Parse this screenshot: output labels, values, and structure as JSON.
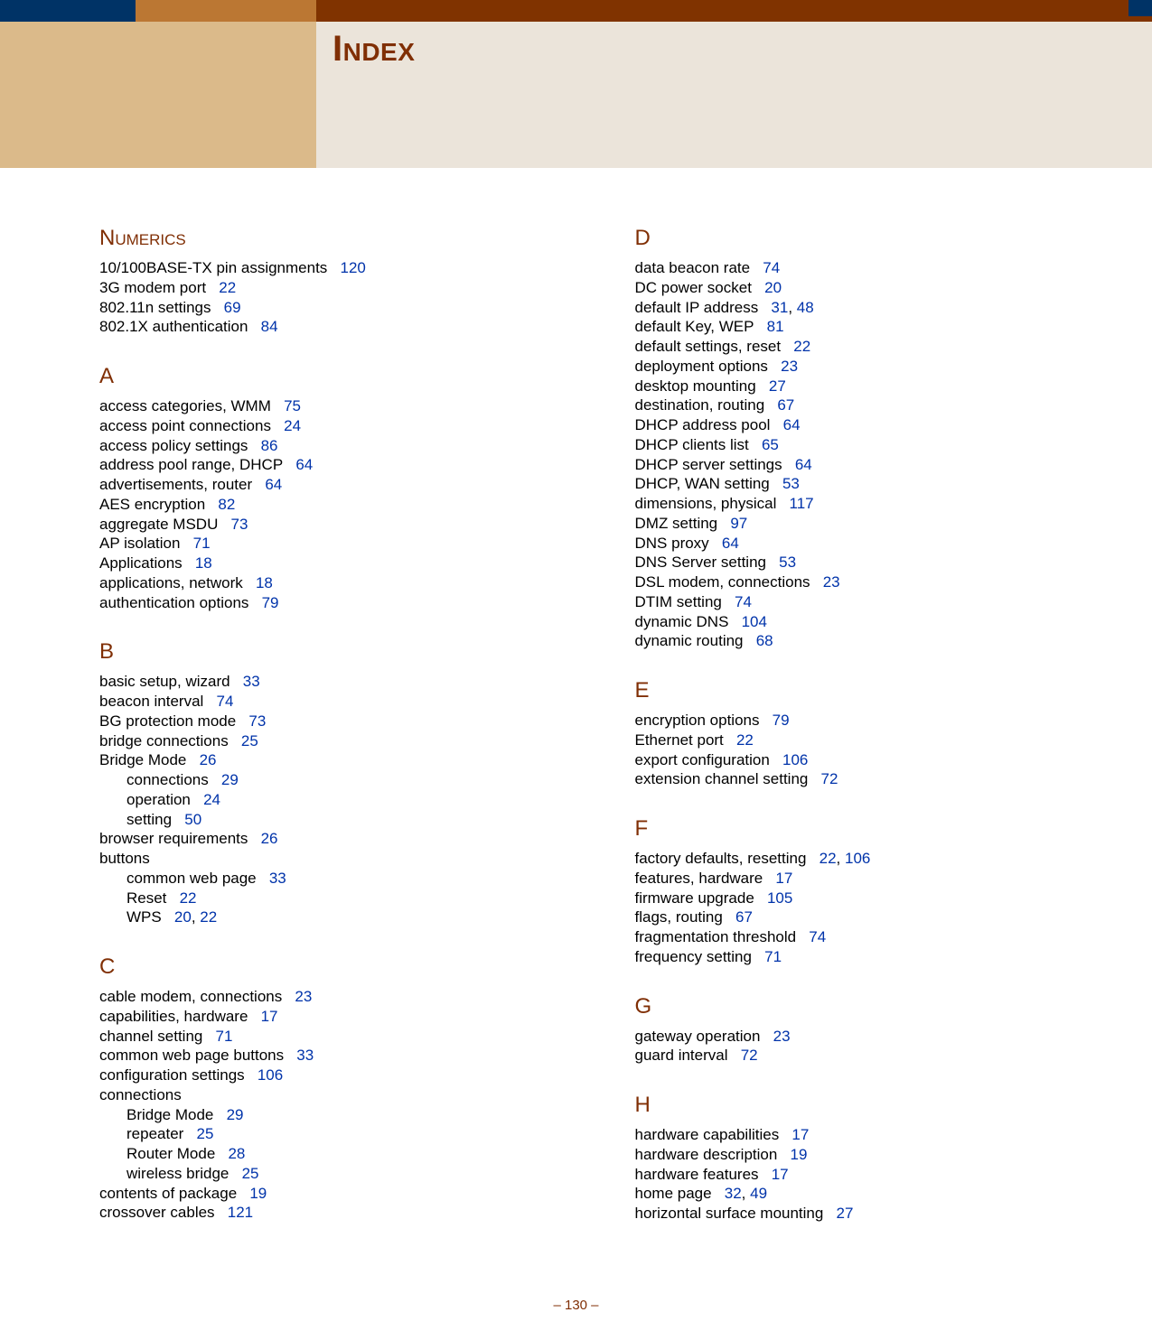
{
  "page_title": "Index",
  "footer_page_number": "–  130  –",
  "columns": [
    [
      {
        "heading": "Numerics",
        "first": true
      },
      {
        "text": "10/100BASE-TX pin assignments",
        "pages": [
          "120"
        ]
      },
      {
        "text": "3G modem port",
        "pages": [
          "22"
        ]
      },
      {
        "text": "802.11n settings",
        "pages": [
          "69"
        ]
      },
      {
        "text": "802.1X authentication",
        "pages": [
          "84"
        ]
      },
      {
        "heading": "A"
      },
      {
        "text": "access categories, WMM",
        "pages": [
          "75"
        ]
      },
      {
        "text": "access point connections",
        "pages": [
          "24"
        ]
      },
      {
        "text": "access policy settings",
        "pages": [
          "86"
        ]
      },
      {
        "text": "address pool range, DHCP",
        "pages": [
          "64"
        ]
      },
      {
        "text": "advertisements, router",
        "pages": [
          "64"
        ]
      },
      {
        "text": "AES encryption",
        "pages": [
          "82"
        ]
      },
      {
        "text": "aggregate MSDU",
        "pages": [
          "73"
        ]
      },
      {
        "text": "AP isolation",
        "pages": [
          "71"
        ]
      },
      {
        "text": "Applications",
        "pages": [
          "18"
        ]
      },
      {
        "text": "applications, network",
        "pages": [
          "18"
        ]
      },
      {
        "text": "authentication options",
        "pages": [
          "79"
        ]
      },
      {
        "heading": "B"
      },
      {
        "text": "basic setup, wizard",
        "pages": [
          "33"
        ]
      },
      {
        "text": "beacon interval",
        "pages": [
          "74"
        ]
      },
      {
        "text": "BG protection mode",
        "pages": [
          "73"
        ]
      },
      {
        "text": "bridge connections",
        "pages": [
          "25"
        ]
      },
      {
        "text": "Bridge Mode",
        "pages": [
          "26"
        ]
      },
      {
        "text": "connections",
        "pages": [
          "29"
        ],
        "sub": true
      },
      {
        "text": "operation",
        "pages": [
          "24"
        ],
        "sub": true
      },
      {
        "text": "setting",
        "pages": [
          "50"
        ],
        "sub": true
      },
      {
        "text": "browser requirements",
        "pages": [
          "26"
        ]
      },
      {
        "text": "buttons"
      },
      {
        "text": "common web page",
        "pages": [
          "33"
        ],
        "sub": true
      },
      {
        "text": "Reset",
        "pages": [
          "22"
        ],
        "sub": true
      },
      {
        "text": "WPS",
        "pages": [
          "20",
          "22"
        ],
        "sub": true
      },
      {
        "heading": "C"
      },
      {
        "text": "cable modem, connections",
        "pages": [
          "23"
        ]
      },
      {
        "text": "capabilities, hardware",
        "pages": [
          "17"
        ]
      },
      {
        "text": "channel setting",
        "pages": [
          "71"
        ]
      },
      {
        "text": "common web page buttons",
        "pages": [
          "33"
        ]
      },
      {
        "text": "configuration settings",
        "pages": [
          "106"
        ]
      },
      {
        "text": "connections"
      },
      {
        "text": "Bridge Mode",
        "pages": [
          "29"
        ],
        "sub": true
      },
      {
        "text": "repeater",
        "pages": [
          "25"
        ],
        "sub": true
      },
      {
        "text": "Router Mode",
        "pages": [
          "28"
        ],
        "sub": true
      },
      {
        "text": "wireless bridge",
        "pages": [
          "25"
        ],
        "sub": true
      },
      {
        "text": "contents of package",
        "pages": [
          "19"
        ]
      },
      {
        "text": "crossover cables",
        "pages": [
          "121"
        ]
      }
    ],
    [
      {
        "heading": "D",
        "first": true
      },
      {
        "text": "data beacon rate",
        "pages": [
          "74"
        ]
      },
      {
        "text": "DC power socket",
        "pages": [
          "20"
        ]
      },
      {
        "text": "default IP address",
        "pages": [
          "31",
          "48"
        ]
      },
      {
        "text": "default Key, WEP",
        "pages": [
          "81"
        ]
      },
      {
        "text": "default settings, reset",
        "pages": [
          "22"
        ]
      },
      {
        "text": "deployment options",
        "pages": [
          "23"
        ]
      },
      {
        "text": "desktop mounting",
        "pages": [
          "27"
        ]
      },
      {
        "text": "destination, routing",
        "pages": [
          "67"
        ]
      },
      {
        "text": "DHCP address pool",
        "pages": [
          "64"
        ]
      },
      {
        "text": "DHCP clients list",
        "pages": [
          "65"
        ]
      },
      {
        "text": "DHCP server settings",
        "pages": [
          "64"
        ]
      },
      {
        "text": "DHCP, WAN setting",
        "pages": [
          "53"
        ]
      },
      {
        "text": "dimensions, physical",
        "pages": [
          "117"
        ]
      },
      {
        "text": "DMZ setting",
        "pages": [
          "97"
        ]
      },
      {
        "text": "DNS proxy",
        "pages": [
          "64"
        ]
      },
      {
        "text": "DNS Server setting",
        "pages": [
          "53"
        ]
      },
      {
        "text": "DSL modem, connections",
        "pages": [
          "23"
        ]
      },
      {
        "text": "DTIM setting",
        "pages": [
          "74"
        ]
      },
      {
        "text": "dynamic DNS",
        "pages": [
          "104"
        ]
      },
      {
        "text": "dynamic routing",
        "pages": [
          "68"
        ]
      },
      {
        "heading": "E"
      },
      {
        "text": "encryption options",
        "pages": [
          "79"
        ]
      },
      {
        "text": "Ethernet port",
        "pages": [
          "22"
        ]
      },
      {
        "text": "export configuration",
        "pages": [
          "106"
        ]
      },
      {
        "text": "extension channel setting",
        "pages": [
          "72"
        ]
      },
      {
        "heading": "F"
      },
      {
        "text": "factory defaults, resetting",
        "pages": [
          "22",
          "106"
        ]
      },
      {
        "text": "features, hardware",
        "pages": [
          "17"
        ]
      },
      {
        "text": "firmware upgrade",
        "pages": [
          "105"
        ]
      },
      {
        "text": "flags, routing",
        "pages": [
          "67"
        ]
      },
      {
        "text": "fragmentation threshold",
        "pages": [
          "74"
        ]
      },
      {
        "text": "frequency setting",
        "pages": [
          "71"
        ]
      },
      {
        "heading": "G"
      },
      {
        "text": "gateway operation",
        "pages": [
          "23"
        ]
      },
      {
        "text": "guard interval",
        "pages": [
          "72"
        ]
      },
      {
        "heading": "H"
      },
      {
        "text": "hardware capabilities",
        "pages": [
          "17"
        ]
      },
      {
        "text": "hardware description",
        "pages": [
          "19"
        ]
      },
      {
        "text": "hardware features",
        "pages": [
          "17"
        ]
      },
      {
        "text": "home page",
        "pages": [
          "32",
          "49"
        ]
      },
      {
        "text": "horizontal surface mounting",
        "pages": [
          "27"
        ]
      }
    ]
  ]
}
